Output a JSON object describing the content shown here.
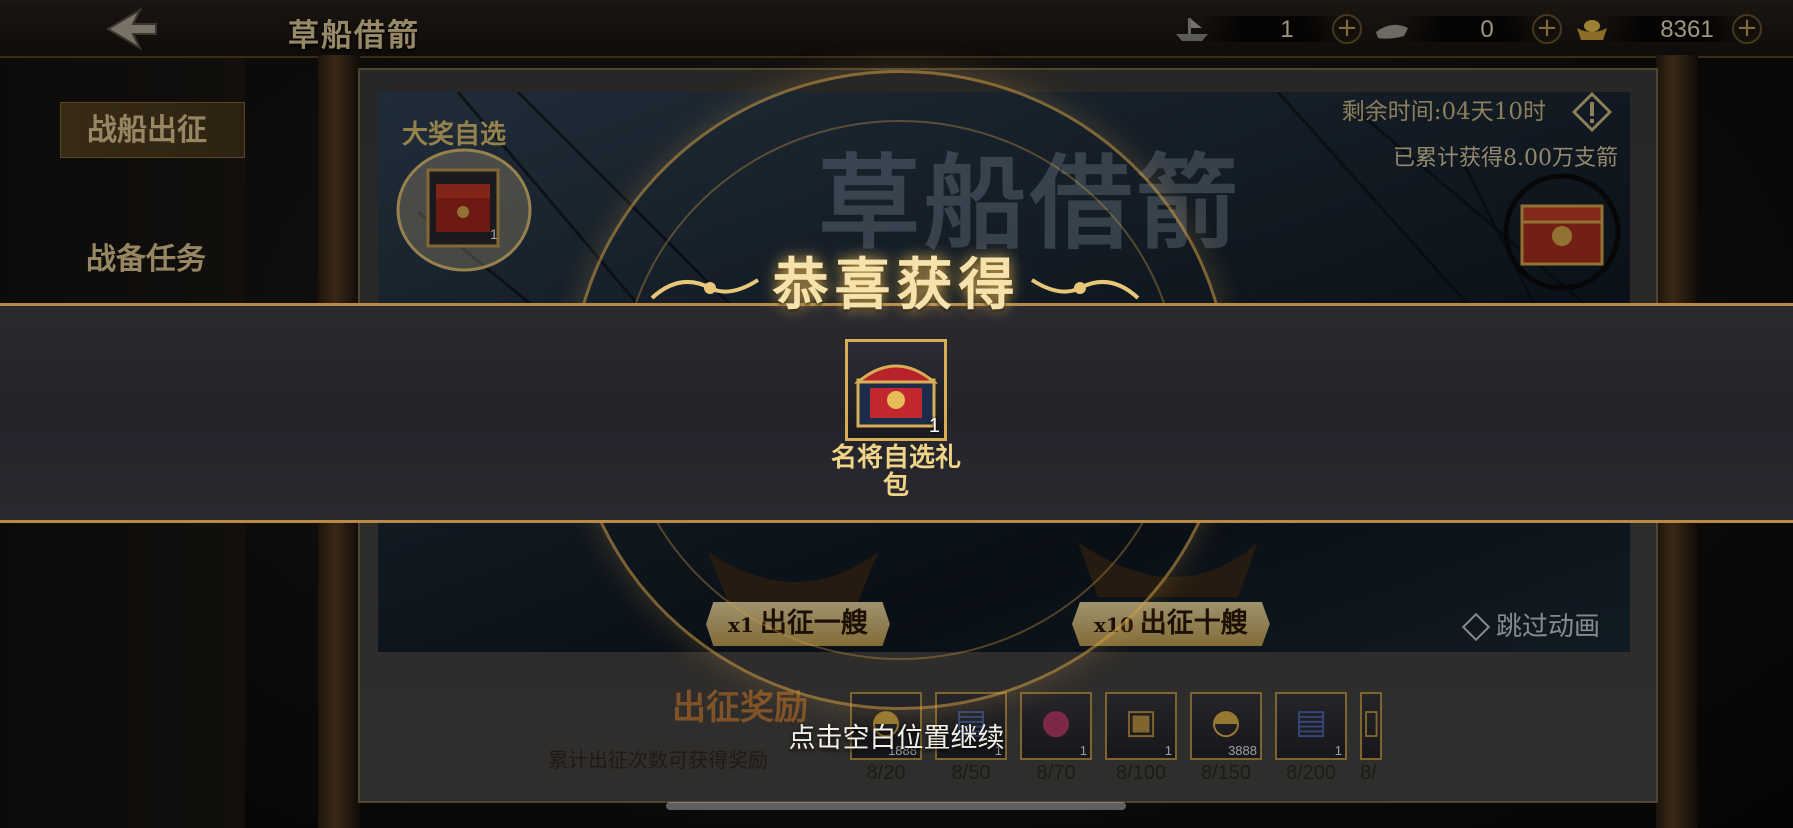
{
  "header": {
    "title": "草船借箭",
    "resources": [
      {
        "icon": "boat-ticket-icon",
        "value": "1"
      },
      {
        "icon": "silver-ingot-icon",
        "value": "0"
      },
      {
        "icon": "gold-ingot-icon",
        "value": "8361"
      }
    ]
  },
  "sidebar": {
    "tabs": [
      {
        "label": "战船出征",
        "active": true
      },
      {
        "label": "战备任务",
        "active": false
      }
    ]
  },
  "banner": {
    "title": "草船借箭",
    "remaining_time": "剩余时间:04天10时",
    "cumulative_arrows": "已累计获得8.00万支箭",
    "grand_prize_label": "大奖自选",
    "grand_prize_count": "1"
  },
  "actions": {
    "go_one_mult": "x1",
    "go_one_label": "出征一艘",
    "go_ten_mult": "x10",
    "go_ten_label": "出征十艘",
    "skip_label": "跳过动画"
  },
  "rewards": {
    "title": "出征奖励",
    "subtitle": "累计出征次数可获得奖励",
    "milestones": [
      {
        "count": "1888",
        "progress": "8/20",
        "icon": "gold-ingot-icon"
      },
      {
        "count": "1",
        "progress": "8/50",
        "icon": "book-icon"
      },
      {
        "count": "1",
        "progress": "8/70",
        "icon": "orb-icon"
      },
      {
        "count": "1",
        "progress": "8/100",
        "icon": "chest-icon"
      },
      {
        "count": "3888",
        "progress": "8/150",
        "icon": "gold-ingot-icon"
      },
      {
        "count": "1",
        "progress": "8/200",
        "icon": "book-icon"
      },
      {
        "count": "",
        "progress": "8/",
        "icon": "unknown-icon"
      }
    ]
  },
  "popup": {
    "title": "恭喜获得",
    "item_name": "名将自选礼包",
    "item_count": "1",
    "continue_hint": "点击空白位置继续"
  }
}
